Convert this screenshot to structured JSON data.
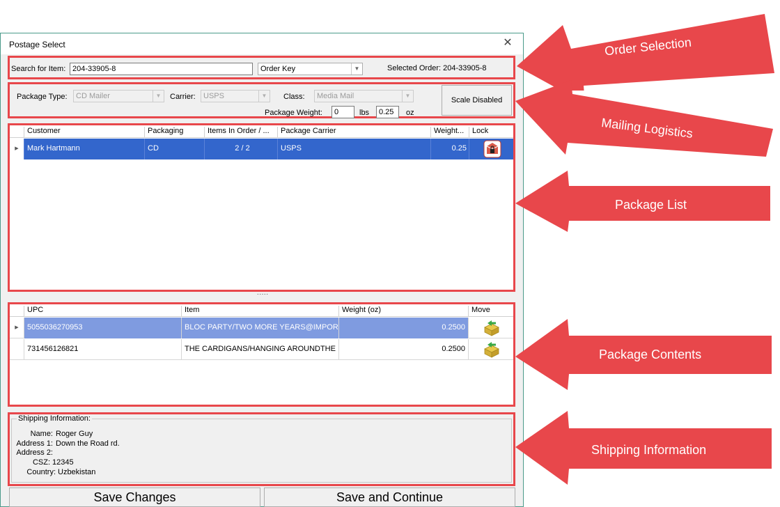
{
  "window": {
    "title": "Postage Select"
  },
  "order_selection": {
    "search_label": "Search for Item:",
    "search_value": "204-33905-8",
    "key_select": "Order Key",
    "selected_order": "Selected Order: 204-33905-8"
  },
  "mailing": {
    "package_type_label": "Package Type:",
    "package_type_value": "CD Mailer",
    "carrier_label": "Carrier:",
    "carrier_value": "USPS",
    "class_label": "Class:",
    "class_value": "Media Mail",
    "weight_label": "Package Weight:",
    "lbs_value": "0",
    "lbs_label": "lbs",
    "oz_value": "0.25",
    "oz_label": "oz",
    "scale_button": "Scale Disabled"
  },
  "package_list": {
    "columns": [
      "Customer",
      "Packaging",
      "Items In Order / ...",
      "Package Carrier",
      "Weight...",
      "Lock"
    ],
    "rows": [
      {
        "customer": "Mark Hartmann",
        "packaging": "CD",
        "items": "2 / 2",
        "carrier": "USPS",
        "weight": "0.25"
      }
    ]
  },
  "splitter": "·····",
  "package_contents": {
    "columns": [
      "UPC",
      "Item",
      "Weight (oz)",
      "Move"
    ],
    "rows": [
      {
        "upc": "5055036270953",
        "item": "BLOC PARTY/TWO MORE YEARS@IMPOR...",
        "weight": "0.2500"
      },
      {
        "upc": "731456126821",
        "item": "THE CARDIGANS/HANGING AROUNDTHE ...",
        "weight": "0.2500"
      }
    ]
  },
  "shipping": {
    "legend": "Shipping Information:",
    "name_label": "Name:",
    "name_value": "Roger Guy",
    "address1_label": "Address 1:",
    "address1_value": "Down the Road rd.",
    "address2_label": "Address 2:",
    "address2_value": "",
    "csz_label": "CSZ:",
    "csz_value": "12345",
    "country_label": "Country:",
    "country_value": "Uzbekistan"
  },
  "buttons": {
    "save_changes": "Save Changes",
    "save_continue": "Save and Continue"
  },
  "callouts": {
    "order_selection": "Order Selection",
    "mailing_logistics": "Mailing Logistics",
    "package_list": "Package List",
    "package_contents": "Package Contents",
    "shipping_information": "Shipping Information"
  },
  "colors": {
    "annotation_red": "#e8474b",
    "selected_row": "#3366cc",
    "selected_row_light": "#7f9be0"
  }
}
